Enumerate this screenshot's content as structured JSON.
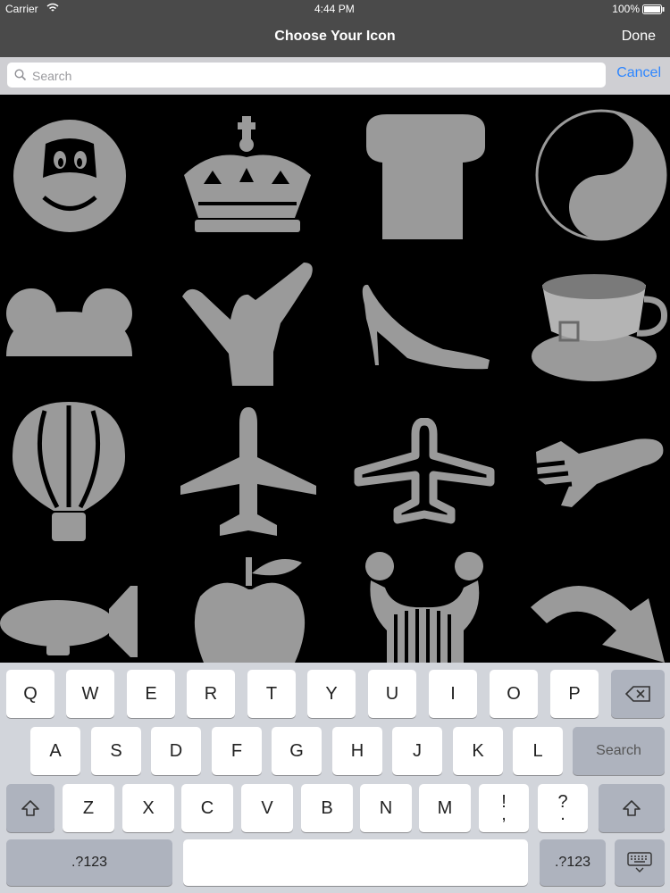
{
  "status_bar": {
    "carrier": "Carrier",
    "time": "4:44 PM",
    "battery": "100%"
  },
  "nav": {
    "title": "Choose Your Icon",
    "done_label": "Done"
  },
  "search": {
    "placeholder": "Search",
    "value": "",
    "cancel_label": "Cancel"
  },
  "icons": [
    "smiley-face-icon",
    "crown-icon",
    "chef-hat-icon",
    "yin-yang-icon",
    "mouse-ears-hat-icon",
    "shaka-hand-icon",
    "high-heel-shoe-icon",
    "teacup-icon",
    "hot-air-balloon-icon",
    "airplane-icon",
    "airplane-outline-icon",
    "fast-plane-icon",
    "blimp-icon",
    "apple-icon",
    "lyre-icon",
    "curved-arrow-icon"
  ],
  "keyboard": {
    "row1": [
      "Q",
      "W",
      "E",
      "R",
      "T",
      "Y",
      "U",
      "I",
      "O",
      "P"
    ],
    "row2": [
      "A",
      "S",
      "D",
      "F",
      "G",
      "H",
      "J",
      "K",
      "L"
    ],
    "row3": [
      "Z",
      "X",
      "C",
      "V",
      "B",
      "N",
      "M",
      "!\n,",
      "?\n."
    ],
    "search_key_label": "Search",
    "numbers_label": ".?123"
  },
  "colors": {
    "icon_gray": "#9a9a9a",
    "accent": "#2e86ff",
    "nav_bg": "#4a4a4a"
  }
}
